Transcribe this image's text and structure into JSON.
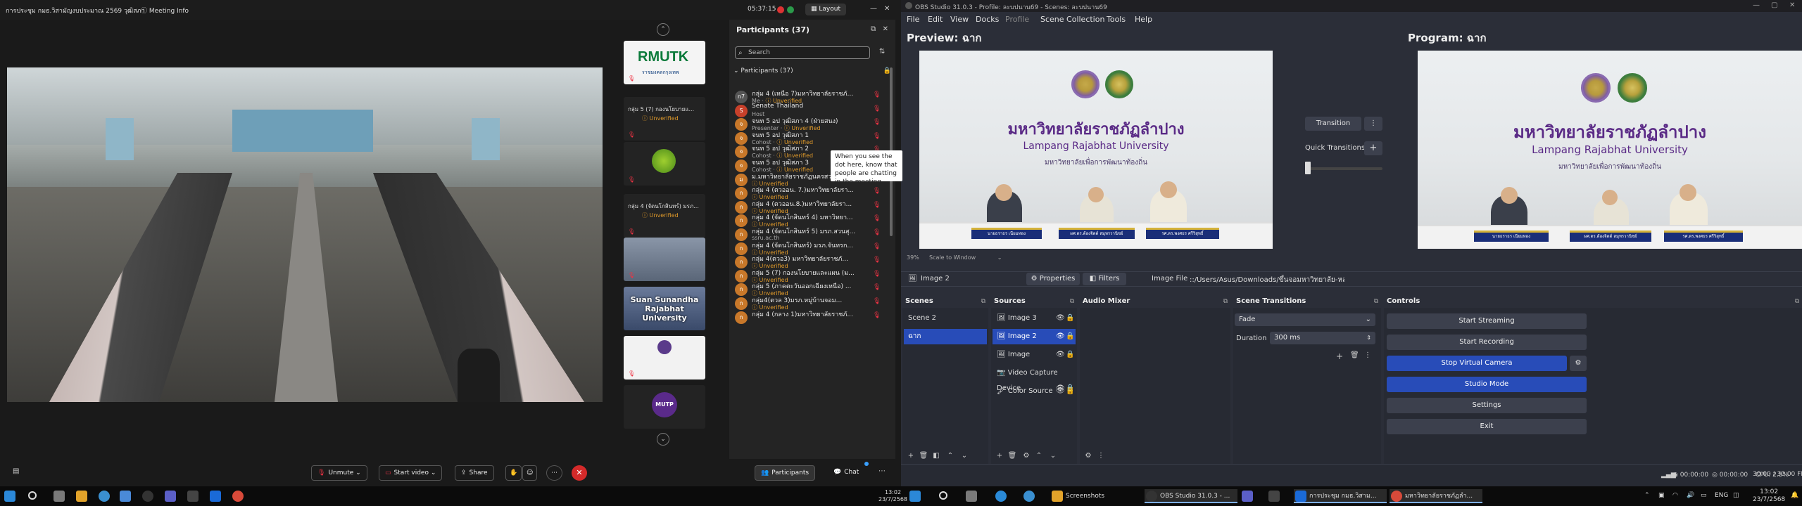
{
  "zoom": {
    "title": "การประชุม กมธ.วิสามัญงบประมาณ 2569 วุฒิสภา",
    "meeting_info": "Meeting Info",
    "clock": "05:37:15",
    "layout_label": "Layout",
    "tiles": [
      {
        "label": "",
        "logo_text": "RMUTK",
        "logo_sub": "ราชมงคลกรุงเทพ"
      },
      {
        "label": "กลุ่ม 5 (7) กองนโยบายแ...",
        "status": "Unverified"
      },
      {
        "label": ""
      },
      {
        "label": "กลุ่ม 4 (จัดนโกสินทร์) มรภ...",
        "status": "Unverified"
      },
      {
        "label": ""
      },
      {
        "label": "Suan Sunandha Rajabhat University"
      },
      {
        "label": ""
      },
      {
        "label": "",
        "logo_text": "MUTP"
      }
    ],
    "participants": {
      "header": "Participants (37)",
      "search_placeholder": "Search",
      "section": "Participants (37)",
      "list": [
        {
          "avatar": "n7",
          "name": "กลุ่ม 4 (เหนือ 7)มหาวิทยาลัยราชภั...",
          "sub": "Me · ",
          "status": "Unverified"
        },
        {
          "avatar": "S",
          "name": "Senate Thailand",
          "sub": "Host",
          "status": ""
        },
        {
          "avatar": "จ",
          "name": "จนท 5 อป วุฒิสภา 4 (ฝ่ายสนง)",
          "sub": "Presenter · ",
          "status": "Unverified"
        },
        {
          "avatar": "จ",
          "name": "จนท 5 อป วุฒิสภา 1",
          "sub": "Cohost · ",
          "status": "Unverified"
        },
        {
          "avatar": "จ",
          "name": "จนท 5 อป วุฒิสภา 2",
          "sub": "Cohost · ",
          "status": "Unverified"
        },
        {
          "avatar": "จ",
          "name": "จนท 5 อป วุฒิสภา 3",
          "sub": "Cohost · ",
          "status": "Unverified"
        },
        {
          "avatar": "ม",
          "name": "ม.มหาวิทยาลัยราชภัฏนครสวรรค์",
          "sub": "",
          "status": "Unverified"
        },
        {
          "avatar": "ก",
          "name": "กลุ่ม 4 (ตวออน. 7.)มหาวิทยาลัยรา...",
          "sub": "",
          "status": "Unverified"
        },
        {
          "avatar": "ก",
          "name": "กลุ่ม 4 (ตวออน.8.)มหาวิทยาลัยรา...",
          "sub": "",
          "status": "Unverified"
        },
        {
          "avatar": "ก",
          "name": "กลุ่ม 4 (จัดนโกสินทร์ 4) มหาวิทยา...",
          "sub": "",
          "status": "Unverified"
        },
        {
          "avatar": "ก",
          "name": "กลุ่ม 4 (จัดนโกสินทร์ 5) มรภ.สวนสุ...",
          "sub": "ssru.ac.th",
          "status": ""
        },
        {
          "avatar": "ก",
          "name": "กลุ่ม 4 (จัดนโกสินทร์) มรภ.จันทรก...",
          "sub": "",
          "status": "Unverified"
        },
        {
          "avatar": "ก",
          "name": "กลุ่ม 4(ตวอ3) มหาวิทยาลัยราชภั...",
          "sub": "",
          "status": "Unverified"
        },
        {
          "avatar": "ก",
          "name": "กลุ่ม 5 (7) กองนโยบายและแผน (ม...",
          "sub": "",
          "status": "Unverified"
        },
        {
          "avatar": "ก",
          "name": "กลุ่ม 5 (ภาคตะวันออกเฉียงเหนือ) ...",
          "sub": "",
          "status": "Unverified"
        },
        {
          "avatar": "ก",
          "name": "กลุ่ม4(ตวล 3)มรภ.หมู่บ้านจอม...",
          "sub": "",
          "status": "Unverified"
        },
        {
          "avatar": "ก",
          "name": "กลุ่ม 4 (กลาง 1)มหาวิทยาลัยราชภั...",
          "sub": "",
          "status": ""
        }
      ]
    },
    "bottom": {
      "unmute": "Unmute",
      "start_video": "Start video",
      "share": "Share",
      "participants": "Participants",
      "chat": "Chat"
    }
  },
  "obs": {
    "title": "OBS Studio 31.0.3 - Profile: ละบปนาน69 - Scenes: ละบปนาน69",
    "menu": [
      "File",
      "Edit",
      "View",
      "Docks",
      "Profile",
      "Scene Collection",
      "Tools",
      "Help"
    ],
    "preview_label": "Preview: ฉาก",
    "program_label": "Program: ฉาก",
    "scene_image": {
      "thai_title": "มหาวิทยาลัยราชภัฏลำปาง",
      "eng_title": "Lampang Rajabhat University",
      "sub_title": "มหาวิทยาลัยเพื่อการพัฒนาท้องถิ่น",
      "nameplates": [
        "นายธราธร เนียมทอง",
        "ผศ.ดร.ต้องจิตต์ สมุทรวานิชย์",
        "รศ.ดร.พงศธร ศรีวิสุทธิ์"
      ]
    },
    "zoom_level": "39%",
    "scale_label": "Scale to Window",
    "transition_btn": "Transition",
    "quick_transitions": "Quick Transitions",
    "context": {
      "source": "Image 2",
      "properties": "Properties",
      "filters": "Filters",
      "image_file_label": "Image File",
      "image_file_path": "::/Users/Asus/Downloads/ขึ้นจอมหาวิทยาลัย-หลอ"
    },
    "tooltip": "When you see the dot here, know that people are chatting in the meeting messages panel.",
    "docks": {
      "scenes": {
        "title": "Scenes",
        "items": [
          "Scene 2",
          "ฉาก"
        ],
        "selected": 1
      },
      "sources": {
        "title": "Sources",
        "items": [
          "Image 3",
          "Image 2",
          "Image",
          "Video Capture Device",
          "Color Source"
        ],
        "selected": 1
      },
      "audio": {
        "title": "Audio Mixer"
      },
      "transitions": {
        "title": "Scene Transitions",
        "type": "Fade",
        "duration_label": "Duration",
        "duration": "300 ms"
      },
      "controls": {
        "title": "Controls",
        "buttons": [
          "Start Streaming",
          "Start Recording",
          "Stop Virtual Camera",
          "Studio Mode",
          "Settings",
          "Exit"
        ]
      }
    },
    "status": {
      "rec_time": "00:00:00",
      "stream_time": "00:00:00",
      "cpu": "CPU: 2.5%",
      "fps": "30.00 / 30.00 FPS"
    }
  },
  "taskbar": {
    "apps": [
      {
        "label": "Screenshots"
      },
      {
        "label": "OBS Studio 31.0.3 - ..."
      },
      {
        "label": ""
      },
      {
        "label": "การประชุม กมธ.วิสาม..."
      },
      {
        "label": "มหาวิทยาลัยราชภัฏลำ..."
      }
    ],
    "lang": "ENG",
    "time": "13:02",
    "date": "23/7/2568",
    "zoom_time": "13:02",
    "zoom_date": "23/7/2568"
  },
  "colors": {
    "obs_bg": "#2b2e38",
    "obs_accent": "#284cb8",
    "zoom_bg": "#1a1a1a",
    "unverified": "#e09a2a",
    "muted_red": "#e33344",
    "university_purple": "#5a2a86"
  }
}
